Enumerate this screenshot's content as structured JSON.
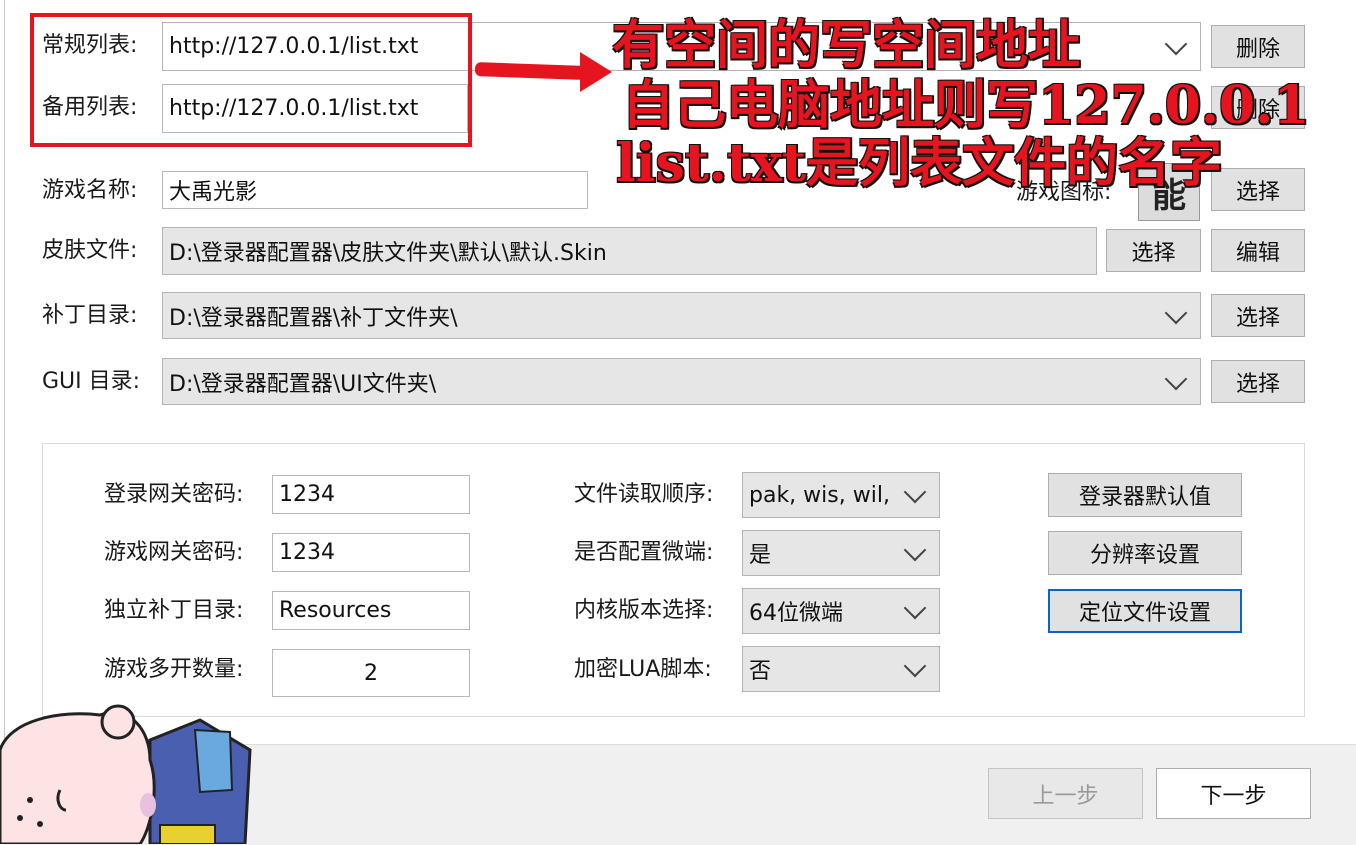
{
  "list": {
    "regular_label": "常规列表:",
    "regular_value": "http://127.0.0.1/list.txt",
    "backup_label": "备用列表:",
    "backup_value": "http://127.0.0.1/list.txt",
    "delete_label": "删除",
    "delete2_label": "删除"
  },
  "annotation": {
    "line1": "有空间的写空间地址",
    "line2": "自己电脑地址则写127.0.0.1",
    "line3": "list.txt是列表文件的名字"
  },
  "game": {
    "name_label": "游戏名称:",
    "name_value": "大禹光影",
    "icon_label": "游戏图标:",
    "icon_glyph": "能",
    "select_label": "选择"
  },
  "skin": {
    "label": "皮肤文件:",
    "value": "D:\\登录器配置器\\皮肤文件夹\\默认\\默认.Skin",
    "select_label": "选择",
    "edit_label": "编辑"
  },
  "patch": {
    "label": "补丁目录:",
    "value": "D:\\登录器配置器\\补丁文件夹\\",
    "select_label": "选择"
  },
  "gui": {
    "label": "GUI 目录:",
    "value": "D:\\登录器配置器\\UI文件夹\\",
    "select_label": "选择"
  },
  "settings": {
    "login_gw_pwd_label": "登录网关密码:",
    "login_gw_pwd_value": "1234",
    "game_gw_pwd_label": "游戏网关密码:",
    "game_gw_pwd_value": "1234",
    "patch_dir_label": "独立补丁目录:",
    "patch_dir_value": "Resources",
    "multi_open_label": "游戏多开数量:",
    "multi_open_value": "2",
    "read_order_label": "文件读取顺序:",
    "read_order_value": "pak, wis, wil,",
    "micro_client_label": "是否配置微端:",
    "micro_client_value": "是",
    "kernel_label": "内核版本选择:",
    "kernel_value": "64位微端",
    "lua_label": "加密LUA脚本:",
    "lua_value": "否",
    "default_btn": "登录器默认值",
    "resolution_btn": "分辨率设置",
    "locate_btn": "定位文件设置"
  },
  "nav": {
    "prev_label": "上一步",
    "next_label": "下一步"
  },
  "colors": {
    "annotation_red": "#e5141f",
    "focus_blue": "#0a64c8"
  }
}
